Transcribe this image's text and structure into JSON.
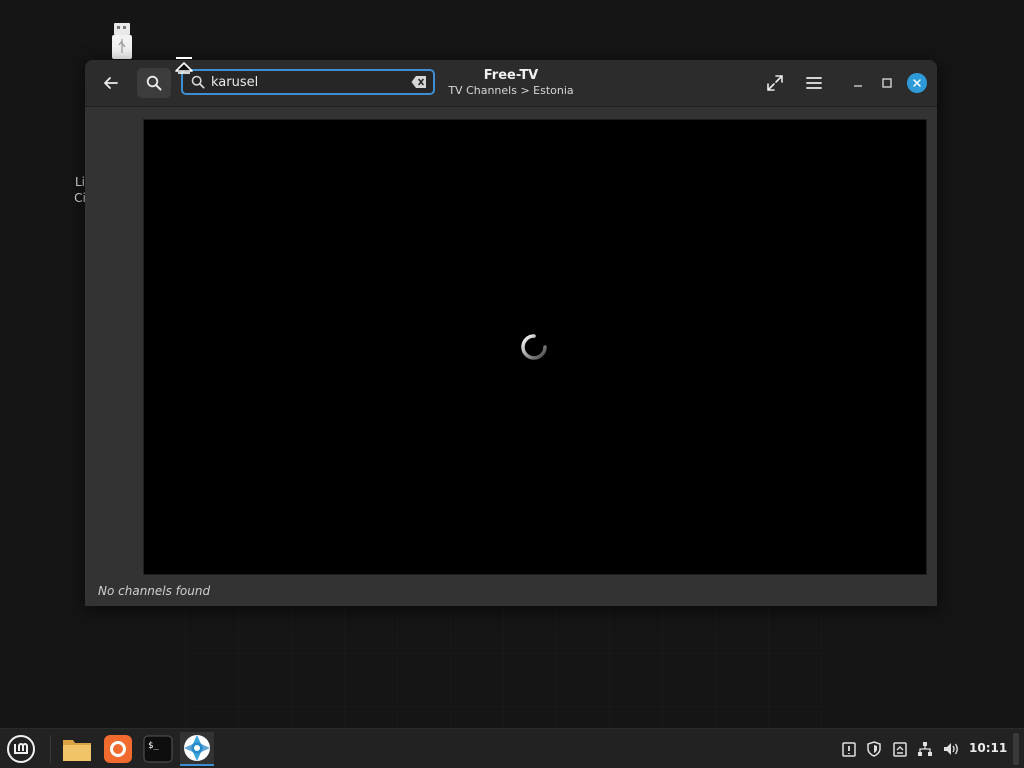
{
  "desktop": {
    "label_fragment_line1": "Li",
    "label_fragment_line2": "Ci"
  },
  "window": {
    "title": "Free-TV",
    "subtitle": "TV Channels > Estonia",
    "search": {
      "value": "karusel",
      "placeholder": ""
    },
    "status": "No channels found",
    "accent_color": "#3d8fd1",
    "close_color": "#2e9bd8"
  },
  "icons": {
    "back": "back-arrow-icon",
    "search_toggle": "search-icon",
    "clear": "clear-backspace-icon",
    "fullscreen": "fullscreen-icon",
    "menu": "hamburger-menu-icon",
    "minimize": "minimize-icon",
    "maximize": "maximize-icon",
    "close": "close-icon",
    "loading": "loading-spinner-icon"
  },
  "taskbar": {
    "clock": "10:11",
    "apps": [
      "menu-icon",
      "files-icon",
      "firefox-icon",
      "terminal-icon",
      "free-tv-icon"
    ],
    "tray": [
      "update-icon",
      "shield-icon",
      "clipboard-icon",
      "network-icon",
      "volume-icon"
    ]
  }
}
